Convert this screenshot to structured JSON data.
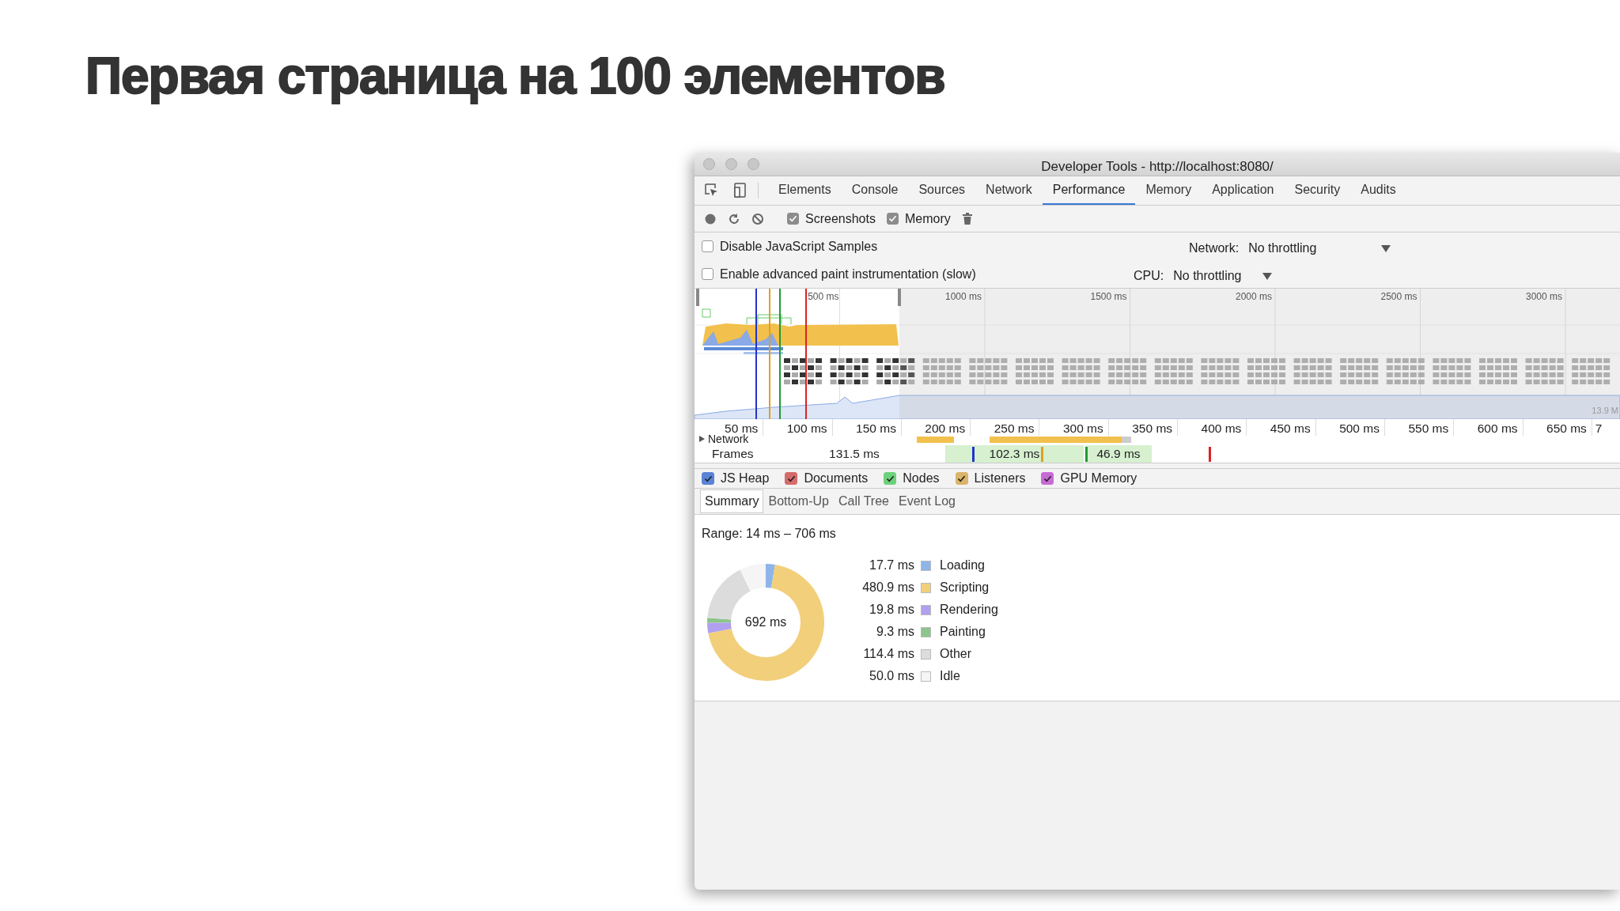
{
  "slide_title": "Первая страница на 100 элементов",
  "window": {
    "title": "Developer Tools - http://localhost:8080/"
  },
  "tabs": [
    {
      "label": "Elements",
      "selected": false
    },
    {
      "label": "Console",
      "selected": false
    },
    {
      "label": "Sources",
      "selected": false
    },
    {
      "label": "Network",
      "selected": false
    },
    {
      "label": "Performance",
      "selected": true
    },
    {
      "label": "Memory",
      "selected": false
    },
    {
      "label": "Application",
      "selected": false
    },
    {
      "label": "Security",
      "selected": false
    },
    {
      "label": "Audits",
      "selected": false
    }
  ],
  "toolbar": {
    "checkboxes": [
      {
        "label": "Screenshots",
        "checked": true
      },
      {
        "label": "Memory",
        "checked": true
      }
    ]
  },
  "settings": [
    {
      "label": "Disable JavaScript Samples",
      "checked": false,
      "throttle_label": "Network:",
      "throttle_value": "No throttling"
    },
    {
      "label": "Enable advanced paint instrumentation (slow)",
      "checked": false,
      "throttle_label": "CPU:",
      "throttle_value": "No throttling"
    }
  ],
  "overview": {
    "ticks": [
      "500 ms",
      "1000 ms",
      "1500 ms",
      "2000 ms",
      "2500 ms",
      "3000 ms"
    ],
    "heap_reading": "13.9 M"
  },
  "ruler": [
    "50 ms",
    "100 ms",
    "150 ms",
    "200 ms",
    "250 ms",
    "300 ms",
    "350 ms",
    "400 ms",
    "450 ms",
    "500 ms",
    "550 ms",
    "600 ms",
    "650 ms",
    "7"
  ],
  "tracks": {
    "network_label": "Network",
    "frames_label": "Frames",
    "frames": [
      "131.5 ms",
      "102.3 ms",
      "46.9 ms"
    ]
  },
  "memory_counters": [
    {
      "label": "JS Heap",
      "checked": true,
      "color": "#5a83d6"
    },
    {
      "label": "Documents",
      "checked": true,
      "color": "#d66a6a"
    },
    {
      "label": "Nodes",
      "checked": true,
      "color": "#6cd17a"
    },
    {
      "label": "Listeners",
      "checked": true,
      "color": "#d9b46a"
    },
    {
      "label": "GPU Memory",
      "checked": true,
      "color": "#c86ad6"
    }
  ],
  "subtabs": [
    {
      "label": "Summary",
      "selected": true
    },
    {
      "label": "Bottom-Up",
      "selected": false
    },
    {
      "label": "Call Tree",
      "selected": false
    },
    {
      "label": "Event Log",
      "selected": false
    }
  ],
  "summary": {
    "range": "Range: 14 ms – 706 ms",
    "total": "692 ms",
    "legend": [
      {
        "value": "17.7 ms",
        "color": "#8db5ea"
      },
      {
        "value": "480.9 ms",
        "color": "#f2cf7a"
      },
      {
        "value": "19.8 ms",
        "color": "#b0a0ee"
      },
      {
        "value": "9.3 ms",
        "color": "#8dc58a"
      },
      {
        "value": "114.4 ms",
        "color": "#dcdcdc"
      },
      {
        "value": "50.0 ms",
        "color": "#f5f5f5"
      }
    ],
    "chart_data": {
      "type": "donut",
      "categories": [
        "Loading",
        "Scripting",
        "Rendering",
        "Painting",
        "Other",
        "Idle"
      ],
      "values": [
        2.56,
        69.49,
        2.86,
        1.34,
        16.53,
        7.22
      ]
    }
  }
}
